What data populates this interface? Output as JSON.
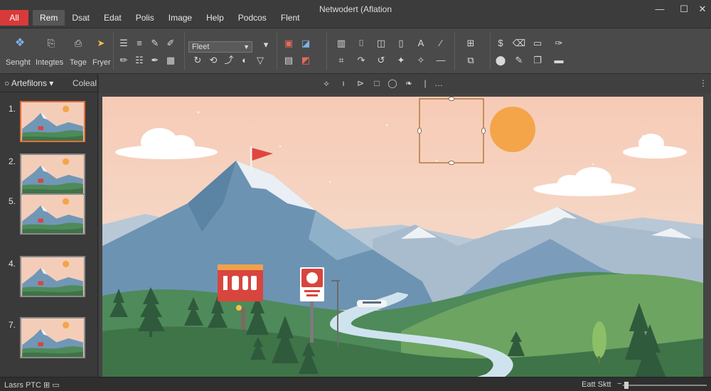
{
  "window": {
    "title": "Netwodert (Aflation",
    "controls": {
      "minimize": "—",
      "restore": "☐",
      "close": "✕"
    }
  },
  "menu": {
    "items": [
      "All",
      "Rem",
      "Dsat",
      "Edat",
      "Polis",
      "Image",
      "Help",
      "Podcos",
      "Flent"
    ]
  },
  "ribbon": {
    "labels": [
      "Senght",
      "Integtes",
      "Tege",
      "Fryer"
    ],
    "font_value": "Fleet"
  },
  "slides_pane": {
    "title": "Artefilons",
    "secondary": "Coleal",
    "numbers": [
      "1.",
      "2.",
      "5.",
      "4.",
      "7."
    ]
  },
  "status": {
    "left": "Lasrs PTC",
    "left_icon": "slide-counter-icon",
    "right": "Eatt  Sktt"
  },
  "colors": {
    "accent": "#d83a3a",
    "selected_thumb": "#e0703a",
    "sky_top": "#f6cfbd",
    "sun": "#f4a54a",
    "flag": "#e0463f"
  }
}
